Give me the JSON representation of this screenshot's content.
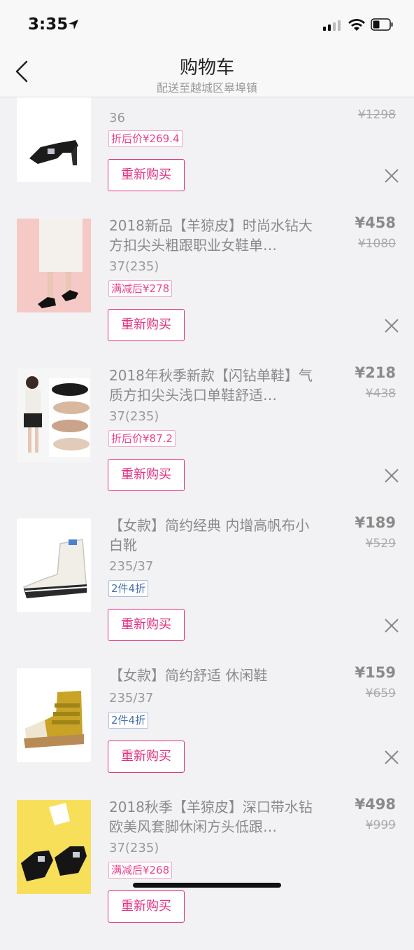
{
  "status": {
    "time": "3:35"
  },
  "nav": {
    "title": "购物车",
    "subtitle": "配送至越城区皋埠镇"
  },
  "items": [
    {
      "name": "",
      "spec": "36",
      "tag": "折后价¥269.4",
      "tag_style": "pink",
      "price": "",
      "orig": "¥1298",
      "rebuy": "重新购买"
    },
    {
      "name": "2018新品【羊猄皮】时尚水钻大方扣尖头粗跟职业女鞋单…",
      "spec": "37(235)",
      "tag": "满减后¥278",
      "tag_style": "pink",
      "price": "¥458",
      "orig": "¥1080",
      "rebuy": "重新购买"
    },
    {
      "name": "2018年秋季新款【闪钻单鞋】气质方扣尖头浅口单鞋舒适…",
      "spec": "37(235)",
      "tag": "折后价¥87.2",
      "tag_style": "pink",
      "price": "¥218",
      "orig": "¥438",
      "rebuy": "重新购买"
    },
    {
      "name": "【女款】简约经典 内增高帆布小白靴",
      "spec": "235/37",
      "tag": "2件4折",
      "tag_style": "blue",
      "price": "¥189",
      "orig": "¥529",
      "rebuy": "重新购买"
    },
    {
      "name": "【女款】简约舒适 休闲鞋",
      "spec": "235/37",
      "tag": "2件4折",
      "tag_style": "blue",
      "price": "¥159",
      "orig": "¥659",
      "rebuy": "重新购买"
    },
    {
      "name": "2018秋季【羊猄皮】深口带水钻欧美风套脚休闲方头低跟…",
      "spec": "37(235)",
      "tag": "满减后¥268",
      "tag_style": "pink",
      "price": "¥498",
      "orig": "¥999",
      "rebuy": "重新购买"
    }
  ]
}
